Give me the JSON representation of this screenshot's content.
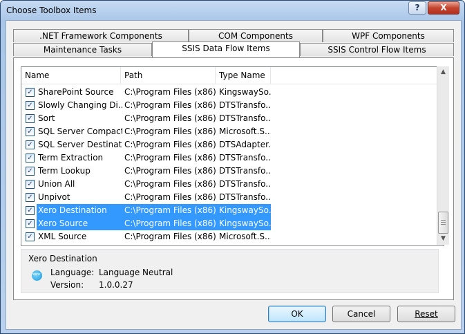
{
  "window": {
    "title": "Choose Toolbox Items"
  },
  "tabs_top": [
    ".NET Framework Components",
    "COM Components",
    "WPF Components"
  ],
  "tabs_bottom": [
    "Maintenance Tasks",
    "SSIS Data Flow Items",
    "SSIS Control Flow Items"
  ],
  "active_tab": "SSIS Data Flow Items",
  "list": {
    "columns": [
      "Name",
      "Path",
      "Type Name"
    ],
    "rows": [
      {
        "name": "SharePoint Source",
        "path": "C:\\Program Files (x86)...",
        "type": "KingswaySo...",
        "checked": true,
        "selected": false
      },
      {
        "name": "Slowly Changing Di...",
        "path": "C:\\Program Files (x86)...",
        "type": "DTSTransfo...",
        "checked": true,
        "selected": false
      },
      {
        "name": "Sort",
        "path": "C:\\Program Files (x86)...",
        "type": "DTSTransfo...",
        "checked": true,
        "selected": false
      },
      {
        "name": "SQL Server Compact ...",
        "path": "C:\\Program Files (x86)...",
        "type": "Microsoft.S...",
        "checked": true,
        "selected": false
      },
      {
        "name": "SQL Server Destination",
        "path": "C:\\Program Files (x86)...",
        "type": "DTSAdapter...",
        "checked": true,
        "selected": false
      },
      {
        "name": "Term Extraction",
        "path": "C:\\Program Files (x86)...",
        "type": "DTSTransfo...",
        "checked": true,
        "selected": false
      },
      {
        "name": "Term Lookup",
        "path": "C:\\Program Files (x86)...",
        "type": "DTSTransfo...",
        "checked": true,
        "selected": false
      },
      {
        "name": "Union All",
        "path": "C:\\Program Files (x86)...",
        "type": "DTSTransfo...",
        "checked": true,
        "selected": false
      },
      {
        "name": "Unpivot",
        "path": "C:\\Program Files (x86)...",
        "type": "DTSTransfo...",
        "checked": true,
        "selected": false
      },
      {
        "name": "Xero Destination",
        "path": "C:\\Program Files (x86)...",
        "type": "KingswaySo...",
        "checked": true,
        "selected": true
      },
      {
        "name": "Xero Source",
        "path": "C:\\Program Files (x86)...",
        "type": "KingswaySo...",
        "checked": true,
        "selected": true
      },
      {
        "name": "XML Source",
        "path": "C:\\Program Files (x86)...",
        "type": "Microsoft.S...",
        "checked": true,
        "selected": false
      }
    ]
  },
  "details": {
    "title": "Xero Destination",
    "icon_text": "xero",
    "language_label": "Language:",
    "language_value": "Language Neutral",
    "version_label": "Version:",
    "version_value": "1.0.0.27"
  },
  "buttons": {
    "ok": "OK",
    "cancel": "Cancel",
    "reset": "Reset"
  },
  "titlebar": {
    "help": "?",
    "close": "X"
  },
  "colors": {
    "selection": "#3399ff",
    "titlebar": "#b9d1ee",
    "close": "#c4452f"
  }
}
